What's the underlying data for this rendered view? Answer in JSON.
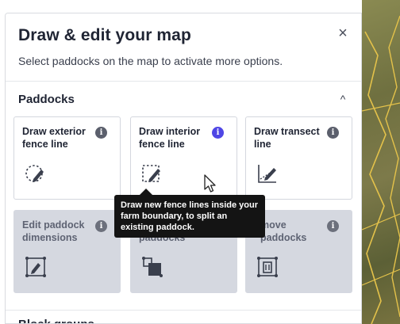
{
  "panel": {
    "title": "Draw & edit your map",
    "subtitle": "Select paddocks on the map to activate more options."
  },
  "icons": {
    "close": "close-icon",
    "info": "info-icon",
    "chevron": "chevron-icon"
  },
  "close_glyph": "×",
  "sections": {
    "paddocks": {
      "title": "Paddocks",
      "chevron": "^"
    },
    "block_groups": {
      "title": "Block groups",
      "chevron": "⌄"
    }
  },
  "cards": [
    {
      "label": "Draw exterior fence line",
      "icon": "dashed-circle-pencil-icon",
      "info": "i",
      "state": "enabled"
    },
    {
      "label": "Draw interior fence line",
      "icon": "dashed-square-pencil-icon",
      "info": "i",
      "state": "enabled",
      "info_highlighted": true
    },
    {
      "label": "Draw transect line",
      "icon": "transect-pencil-icon",
      "info": "i",
      "state": "enabled"
    },
    {
      "label": "Edit paddock dimensions",
      "icon": "edit-paddock-icon",
      "info": "i",
      "state": "disabled"
    },
    {
      "label": "paddocks",
      "icon": "merge-paddocks-icon",
      "info": "i",
      "state": "disabled"
    },
    {
      "label": "move paddocks",
      "icon": "remove-paddock-icon",
      "info": "i",
      "state": "disabled"
    }
  ],
  "tooltip": {
    "text": "Draw new fence lines inside your farm boundary, to split an existing paddock."
  },
  "colors": {
    "accent_info": "#4f46e5",
    "tooltip_bg": "#141414",
    "disabled_card": "#d5d8e0"
  }
}
